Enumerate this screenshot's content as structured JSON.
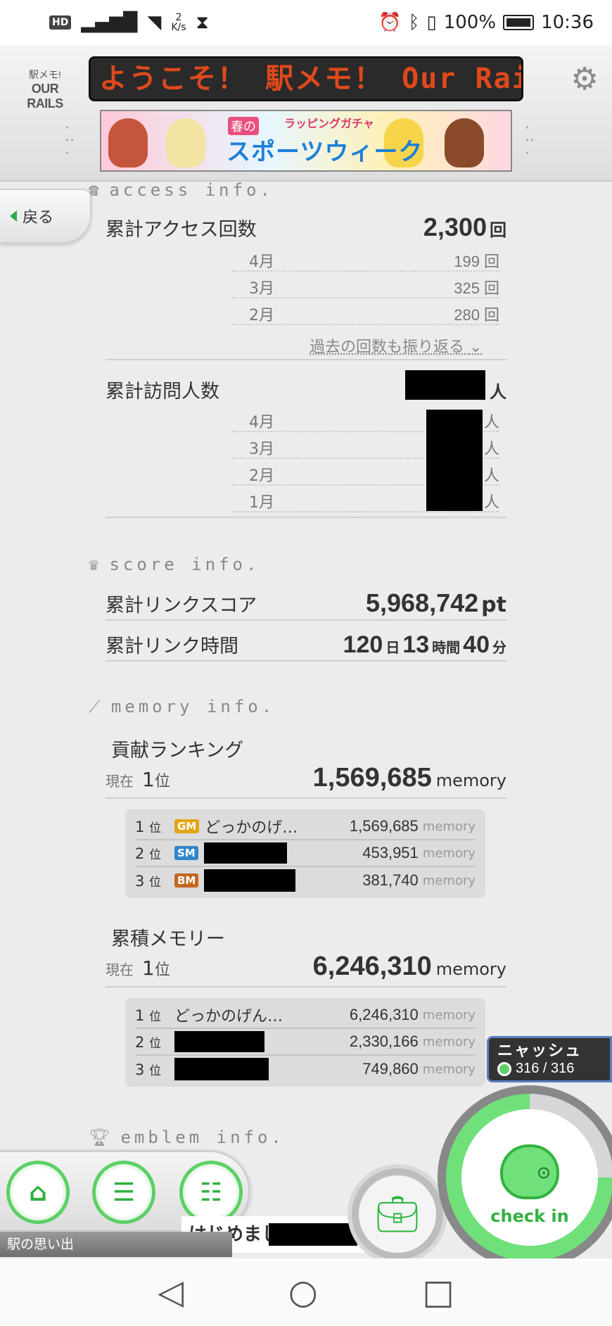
{
  "status_bar": {
    "hd": "HD",
    "network_speed": "2\nK/s",
    "battery": "100%",
    "time": "10:36"
  },
  "header": {
    "logo_line1": "駅メモ!",
    "logo_line2": "OUR RAILS",
    "marquee": "ようこそ！ 駅メモ！ Our Rails",
    "banner_sub": "ラッピングガチャ",
    "banner_spring": "春の",
    "banner_main": "スポーツウィーク"
  },
  "back_button": "戻る",
  "access_info": {
    "heading": "access info.",
    "total_label": "累計アクセス回数",
    "total_value": "2,300",
    "total_unit": "回",
    "months": [
      {
        "month": "4月",
        "value": "199",
        "unit": "回"
      },
      {
        "month": "3月",
        "value": "325",
        "unit": "回"
      },
      {
        "month": "2月",
        "value": "280",
        "unit": "回"
      }
    ],
    "more_link": "過去の回数も振り返る",
    "visitors_label": "累計訪問人数",
    "visitors_unit": "人",
    "visitor_months": [
      {
        "month": "4月",
        "unit": "人"
      },
      {
        "month": "3月",
        "unit": "人"
      },
      {
        "month": "2月",
        "unit": "人"
      },
      {
        "month": "1月",
        "unit": "人"
      }
    ]
  },
  "score_info": {
    "heading": "score info.",
    "score_label": "累計リンクスコア",
    "score_value": "5,968,742",
    "score_unit": "pt",
    "time_label": "累計リンク時間",
    "days": "120",
    "days_unit": "日",
    "hours": "13",
    "hours_unit": "時間",
    "minutes": "40",
    "minutes_unit": "分"
  },
  "memory_info": {
    "heading": "memory info.",
    "contrib": {
      "title": "貢献ランキング",
      "now_prefix": "現在",
      "rank": "1",
      "rank_unit": "位",
      "value": "1,569,685",
      "unit": "memory",
      "rows": [
        {
          "pos": "1",
          "pos_unit": "位",
          "badge": "GM",
          "badge_color": "#e2a516",
          "name": "どっかのげ…",
          "score": "1,569,685",
          "unit": "memory"
        },
        {
          "pos": "2",
          "pos_unit": "位",
          "badge": "SM",
          "badge_color": "#2f86c9",
          "name": "",
          "score": "453,951",
          "unit": "memory"
        },
        {
          "pos": "3",
          "pos_unit": "位",
          "badge": "BM",
          "badge_color": "#c5671f",
          "name": "",
          "score": "381,740",
          "unit": "memory"
        }
      ]
    },
    "accum": {
      "title": "累積メモリー",
      "now_prefix": "現在",
      "rank": "1",
      "rank_unit": "位",
      "value": "6,246,310",
      "unit": "memory",
      "rows": [
        {
          "pos": "1",
          "pos_unit": "位",
          "name": "どっかのげん…",
          "score": "6,246,310",
          "unit": "memory"
        },
        {
          "pos": "2",
          "pos_unit": "位",
          "name": "",
          "score": "2,330,166",
          "unit": "memory"
        },
        {
          "pos": "3",
          "pos_unit": "位",
          "name": "",
          "score": "749,860",
          "unit": "memory"
        }
      ]
    }
  },
  "emblem_info": {
    "heading": "emblem info."
  },
  "nyash": {
    "title": "ニャッシュ",
    "count": "316 / 316"
  },
  "checkin": {
    "label": "check in"
  },
  "bottom": {
    "memory_bar": "駅の思い出",
    "greeting": "はじめまして"
  },
  "colors": {
    "accent_green": "#31b240",
    "light_green": "#6fe07a",
    "marquee_orange": "#e0491b"
  }
}
